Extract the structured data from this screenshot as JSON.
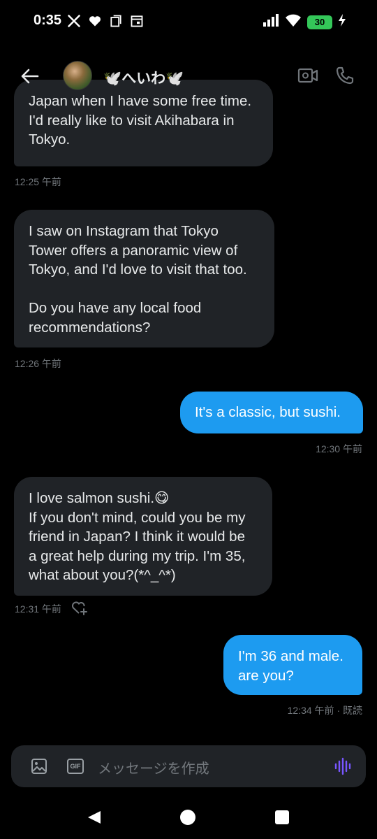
{
  "status_bar": {
    "time": "0:35",
    "battery": "30",
    "left_icons": [
      "x-logo-icon",
      "heart-icon",
      "copy-icon",
      "calendar-icon"
    ],
    "right_icons": [
      "signal-icon",
      "wifi-icon",
      "battery-icon",
      "charging-icon"
    ],
    "battery_color": "#34c759"
  },
  "header": {
    "contact_name": "🕊️へいわ🕊️",
    "back_icon": "back-arrow-icon",
    "video_icon": "video-call-icon",
    "phone_icon": "phone-icon"
  },
  "messages": [
    {
      "direction": "in",
      "lines": [
        "Japan when I have some free time.",
        "I'd really like to visit Akihabara in",
        "Tokyo."
      ],
      "time": "12:25 午前"
    },
    {
      "direction": "in",
      "lines": [
        "I saw on Instagram that Tokyo",
        "Tower offers a panoramic view of",
        "Tokyo, and I'd love to visit that too.",
        "",
        "Do you have any local food",
        "recommendations?"
      ],
      "time": "12:26 午前"
    },
    {
      "direction": "out",
      "lines": [
        "It's a classic, but sushi."
      ],
      "time": "12:30 午前"
    },
    {
      "direction": "in",
      "lines": [
        "I love salmon sushi.😋",
        "If you don't mind, could you be my",
        "friend in Japan? I think it would be",
        "a great help during my trip. I'm 35,",
        "what about you?(*^_^*)"
      ],
      "time": "12:31 午前"
    },
    {
      "direction": "out",
      "lines": [
        "I'm 36 and male.",
        "are you?"
      ],
      "time": "12:34 午前 · 既読"
    }
  ],
  "composer": {
    "placeholder": "メッセージを作成",
    "gif_label": "GIF",
    "voice_color": "#7856ff"
  },
  "colors": {
    "background": "#000000",
    "incoming_bubble": "#202327",
    "outgoing_bubble": "#1d9bf0",
    "timestamp": "#71767b"
  }
}
